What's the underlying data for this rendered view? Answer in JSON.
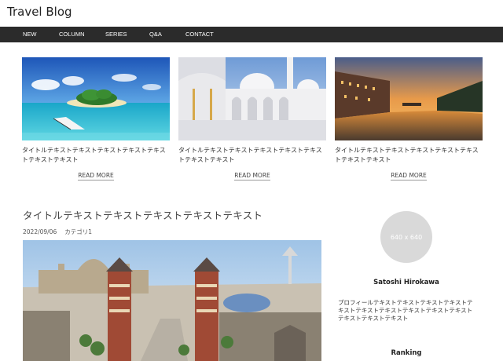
{
  "site": {
    "title": "Travel Blog"
  },
  "nav": {
    "items": [
      "NEW",
      "COLUMN",
      "SERIES",
      "Q&A",
      "CONTACT"
    ]
  },
  "cards": [
    {
      "title": "タイトルテキストテキストテキストテキストテキストテキストテキスト",
      "more": "READ MORE"
    },
    {
      "title": "タイトルテキストテキストテキストテキストテキストテキストテキスト",
      "more": "READ MORE"
    },
    {
      "title": "タイトルテキストテキストテキストテキストテキストテキストテキスト",
      "more": "READ MORE"
    }
  ],
  "post": {
    "title": "タイトルテキストテキストテキストテキストテキスト",
    "date": "2022/09/06",
    "category": "カテゴリ1"
  },
  "sidebar": {
    "avatar_placeholder": "640 x 640",
    "author_name": "Satoshi Hirokawa",
    "author_bio": "プロフィールテキストテキストテキストテキストテキストテキストテキストテキストテキストテキストテキストテキストテキスト",
    "ranking_heading": "Ranking"
  }
}
